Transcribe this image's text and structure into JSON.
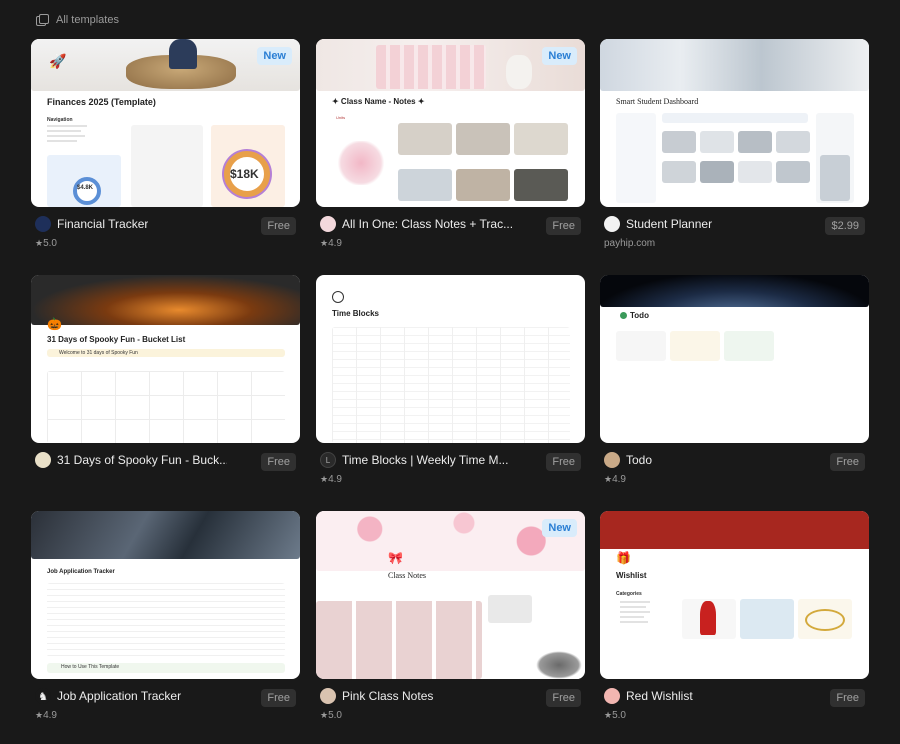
{
  "header": {
    "title": "All templates"
  },
  "cards": [
    {
      "title": "Financial Tracker",
      "price": "Free",
      "sub": "5.0",
      "new": "New",
      "thumb_title": "Finances 2025 (Template)",
      "figure": "$4.8K",
      "figure2": "$18K",
      "nav_label": "Navigation"
    },
    {
      "title": "All In One: Class Notes + Trac...",
      "price": "Free",
      "sub": "4.9",
      "new": "New",
      "thumb_title": "✦ Class Name - Notes ✦",
      "section": "Units"
    },
    {
      "title": "Student Planner",
      "price": "$2.99",
      "sub": "payhip.com",
      "new": "",
      "thumb_title": "Smart Student Dashboard"
    },
    {
      "title": "31 Days of Spooky Fun - Buck...",
      "price": "Free",
      "sub": "",
      "new": "",
      "thumb_title": "31 Days of Spooky Fun - Bucket List",
      "callout": "Welcome to 31 days of Spooky Fun"
    },
    {
      "title": "Time Blocks | Weekly Time M...",
      "price": "Free",
      "sub": "4.9",
      "new": "",
      "thumb_title": "Time Blocks"
    },
    {
      "title": "Todo",
      "price": "Free",
      "sub": "4.9",
      "new": "",
      "thumb_title": "Todo"
    },
    {
      "title": "Job Application Tracker",
      "price": "Free",
      "sub": "4.9",
      "new": "",
      "thumb_title": "Job Application Tracker",
      "footer": "How to Use This Template"
    },
    {
      "title": "Pink Class Notes",
      "price": "Free",
      "sub": "5.0",
      "new": "New",
      "thumb_title": "Class Notes"
    },
    {
      "title": "Red Wishlist",
      "price": "Free",
      "sub": "5.0",
      "new": "",
      "thumb_title": "Wishlist",
      "section": "Categories"
    }
  ],
  "colors": {
    "background": "#191919",
    "new_badge_bg": "#d9ecfb",
    "new_badge_text": "#2b7fd4",
    "price_bg": "#303030"
  }
}
